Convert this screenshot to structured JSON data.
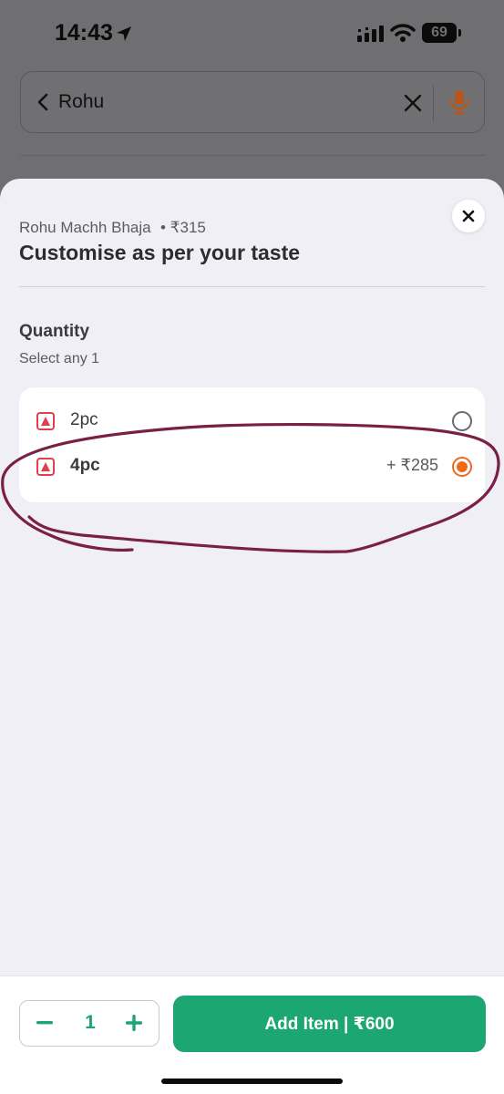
{
  "status_bar": {
    "time": "14:43",
    "battery": "69",
    "icons": [
      "location-arrow-icon",
      "signal-icon",
      "wifi-icon",
      "battery-icon"
    ]
  },
  "search": {
    "query": "Rohu",
    "icons": [
      "back-arrow-icon",
      "clear-x-icon",
      "microphone-icon"
    ]
  },
  "sheet": {
    "item_name": "Rohu Machh Bhaja",
    "item_price": "• ₹315",
    "title": "Customise as per your taste",
    "section": {
      "title": "Quantity",
      "subtitle": "Select any 1",
      "options": [
        {
          "label": "2pc",
          "price": "",
          "selected": false
        },
        {
          "label": "4pc",
          "price": "+ ₹285",
          "selected": true
        }
      ]
    }
  },
  "footer": {
    "quantity": "1",
    "minus_symbol": "−",
    "plus_symbol": "+",
    "add_label": "Add Item | ₹600"
  },
  "colors": {
    "accent_green": "#1ba672",
    "radio_orange": "#ef6a1c",
    "nonveg_red": "#e0404b",
    "annotation_maroon": "#7a1f45",
    "mic_orange": "#b8551c"
  }
}
